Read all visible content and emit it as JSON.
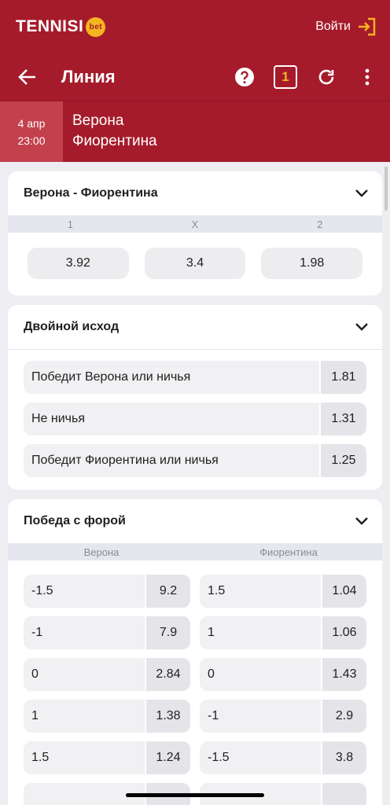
{
  "brand": {
    "name": "TENNISI",
    "badge": "bet",
    "login": "Войти",
    "accent": "#a51b2b",
    "badge_color": "#f5b521"
  },
  "nav": {
    "title": "Линия",
    "coupon_count": "1",
    "icons": [
      "arrow-left-icon",
      "help-icon",
      "coupon-icon",
      "refresh-icon",
      "more-vert-icon"
    ]
  },
  "event": {
    "date": "4 апр",
    "time": "23:00",
    "team1": "Верона",
    "team2": "Фиорентина"
  },
  "match_result": {
    "title": "Верона - Фиорентина",
    "cols": [
      "1",
      "X",
      "2"
    ],
    "odds": [
      "3.92",
      "3.4",
      "1.98"
    ]
  },
  "double_chance": {
    "title": "Двойной исход",
    "items": [
      {
        "label": "Победит Верона или ничья",
        "odd": "1.81"
      },
      {
        "label": "Не ничья",
        "odd": "1.31"
      },
      {
        "label": "Победит Фиорентина или ничья",
        "odd": "1.25"
      }
    ]
  },
  "handicap": {
    "title": "Победа с форой",
    "cols": [
      "Верона",
      "Фиорентина"
    ],
    "rows": [
      {
        "h1": "-1.5",
        "o1": "9.2",
        "h2": "1.5",
        "o2": "1.04"
      },
      {
        "h1": "-1",
        "o1": "7.9",
        "h2": "1",
        "o2": "1.06"
      },
      {
        "h1": "0",
        "o1": "2.84",
        "h2": "0",
        "o2": "1.43"
      },
      {
        "h1": "1",
        "o1": "1.38",
        "h2": "-1",
        "o2": "2.9"
      },
      {
        "h1": "1.5",
        "o1": "1.24",
        "h2": "-1.5",
        "o2": "3.8"
      }
    ]
  }
}
